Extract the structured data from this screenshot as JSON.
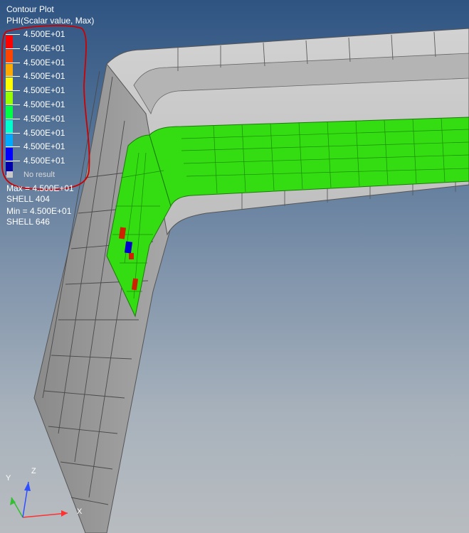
{
  "legend": {
    "title": "Contour Plot",
    "subtitle": "PHI(Scalar value, Max)",
    "entries": [
      {
        "label": "4.500E+01",
        "color": "#ff0000"
      },
      {
        "label": "4.500E+01",
        "color": "#ff4400"
      },
      {
        "label": "4.500E+01",
        "color": "#ffaa00"
      },
      {
        "label": "4.500E+01",
        "color": "#ffff00"
      },
      {
        "label": "4.500E+01",
        "color": "#99ff00"
      },
      {
        "label": "4.500E+01",
        "color": "#00ff44"
      },
      {
        "label": "4.500E+01",
        "color": "#00ffcc"
      },
      {
        "label": "4.500E+01",
        "color": "#00aaff"
      },
      {
        "label": "4.500E+01",
        "color": "#0000ff"
      },
      {
        "label": "4.500E+01",
        "color": "#0000aa"
      }
    ],
    "no_result_label": "No result",
    "highlight_color": "#cc0000"
  },
  "info": {
    "max_line": "Max = 4.500E+01",
    "max_element": "SHELL 404",
    "min_line": "Min = 4.500E+01",
    "min_element": "SHELL 646"
  },
  "triad": {
    "x_label": "X",
    "y_label": "Y",
    "z_label": "Z",
    "x_color": "#ff3030",
    "y_color": "#30c030",
    "z_color": "#3050ff"
  },
  "model": {
    "mesh_color": "#c8c8c8",
    "contour_color": "#33dd11",
    "element_highlight_red": "#cc2200",
    "element_highlight_blue": "#0000cc"
  }
}
